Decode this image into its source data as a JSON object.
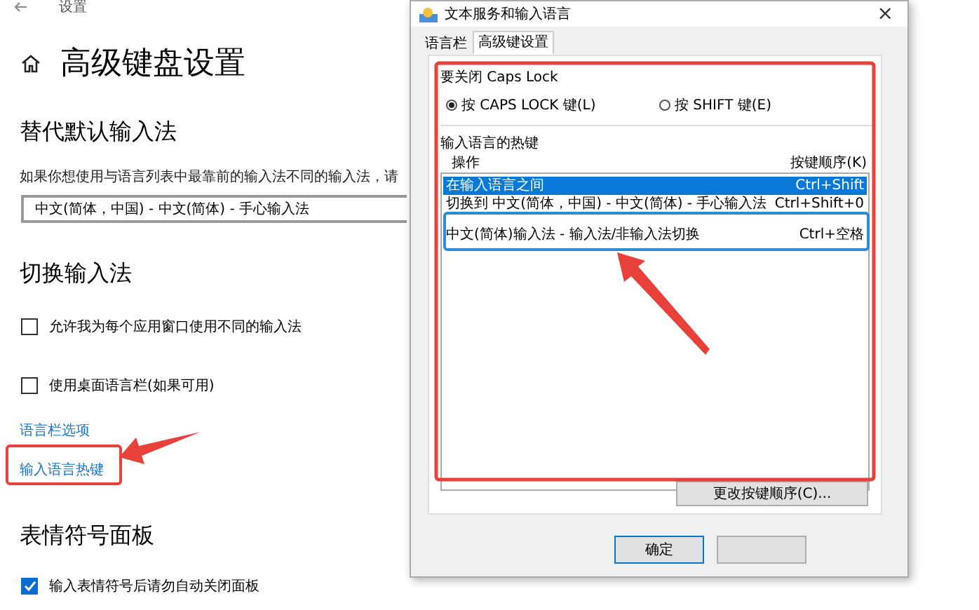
{
  "settings": {
    "window_title": "设置",
    "heading": "高级键盘设置",
    "override": {
      "title": "替代默认输入法",
      "description": "如果你想使用与语言列表中最靠前的输入法不同的输入法，请",
      "dropdown": {
        "value": "中文(简体，中国) - 中文(简体) - 手心输入法"
      }
    },
    "switching": {
      "title": "切换输入法",
      "options": [
        {
          "label": "允许我为每个应用窗口使用不同的输入法",
          "checked": false
        },
        {
          "label": "使用桌面语言栏(如果可用)",
          "checked": false
        }
      ],
      "links": [
        "语言栏选项",
        "输入语言热键"
      ]
    },
    "emoji": {
      "title": "表情符号面板",
      "options": [
        {
          "label": "输入表情符号后请勿自动关闭面板",
          "checked": true
        }
      ]
    }
  },
  "dialog": {
    "title": "文本服务和输入语言",
    "close": "×",
    "tabs": [
      {
        "label": "语言栏",
        "selected": false
      },
      {
        "label": "高级键设置",
        "selected": true
      }
    ],
    "caps_lock": {
      "title": "要关闭 Caps Lock",
      "options": [
        {
          "label": "按 CAPS LOCK 键(L)",
          "selected": true
        },
        {
          "label": "按 SHIFT 键(E)",
          "selected": false
        }
      ]
    },
    "hotkeys": {
      "title": "输入语言的热键",
      "columns": [
        "操作",
        "按键顺序(K)"
      ],
      "rows": [
        {
          "action": "在输入语言之间",
          "keys": "Ctrl+Shift",
          "selected": true
        },
        {
          "action": "切换到 中文(简体，中国) - 中文(简体) - 手心输入法",
          "keys": "Ctrl+Shift+0",
          "selected": false
        },
        {
          "action": "中文(简体)输入法 - 输入法/非输入法切换",
          "keys": "Ctrl+空格",
          "selected": false
        }
      ]
    },
    "change_button": "更改按键顺序(C)...",
    "ok_button": "确定"
  }
}
